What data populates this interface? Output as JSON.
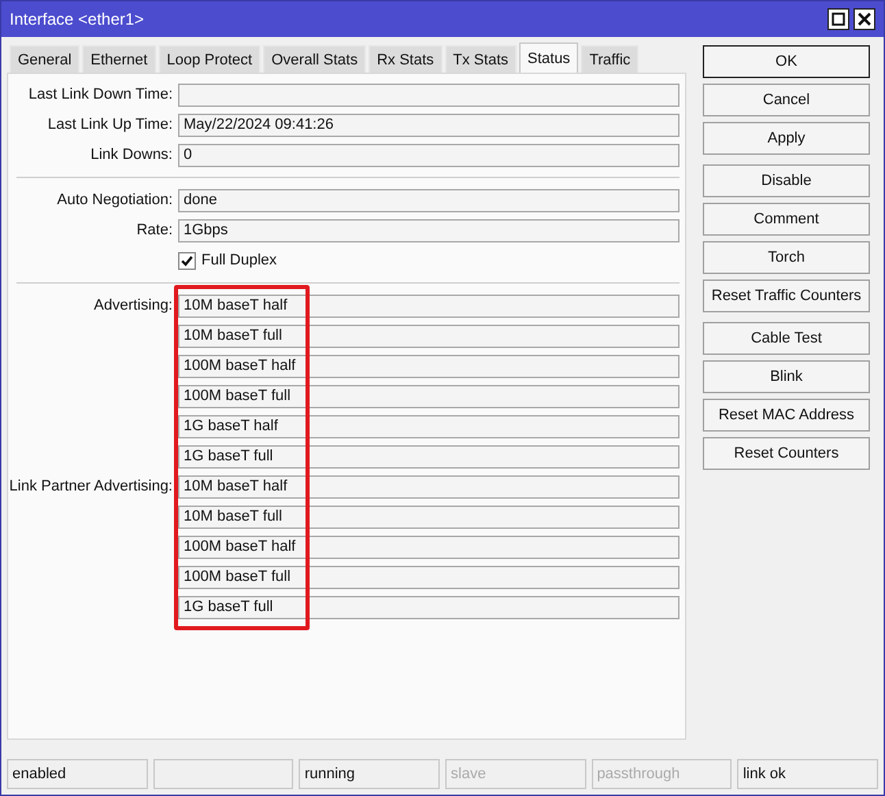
{
  "window": {
    "title": "Interface <ether1>"
  },
  "tabs": [
    {
      "label": "General",
      "selected": false
    },
    {
      "label": "Ethernet",
      "selected": false
    },
    {
      "label": "Loop Protect",
      "selected": false
    },
    {
      "label": "Overall Stats",
      "selected": false
    },
    {
      "label": "Rx Stats",
      "selected": false
    },
    {
      "label": "Tx Stats",
      "selected": false
    },
    {
      "label": "Status",
      "selected": true
    },
    {
      "label": "Traffic",
      "selected": false
    }
  ],
  "link_fields": [
    {
      "label": "Last Link Down Time:"
    },
    {
      "label": "Last Link Up Time:",
      "value": "May/22/2024 09:41:26"
    },
    {
      "label": "Link Downs:",
      "value": "0"
    }
  ],
  "negotiation_fields": [
    {
      "label": "Auto Negotiation:",
      "value": "done"
    },
    {
      "label": "Rate:",
      "value": "1Gbps"
    }
  ],
  "full_duplex": {
    "label": "Full Duplex",
    "checked": true
  },
  "advertising": {
    "label": "Advertising:",
    "items": [
      "10M baseT half",
      "10M baseT full",
      "100M baseT half",
      "100M baseT full",
      "1G baseT half",
      "1G baseT full"
    ]
  },
  "link_partner_advertising": {
    "label": "Link Partner Advertising:",
    "items": [
      "10M baseT half",
      "10M baseT full",
      "100M baseT half",
      "100M baseT full",
      "1G baseT full"
    ]
  },
  "button_groups": [
    [
      "OK",
      "Cancel",
      "Apply"
    ],
    [
      "Disable",
      "Comment",
      "Torch",
      "Reset Traffic Counters"
    ],
    [
      "Cable Test",
      "Blink",
      "Reset MAC Address",
      "Reset Counters"
    ]
  ],
  "status_bar": {
    "left": [
      {
        "text": "enabled",
        "disabled": false
      }
    ],
    "right": [
      {
        "text": "running",
        "disabled": false
      },
      {
        "text": "slave",
        "disabled": true
      },
      {
        "text": "passthrough",
        "disabled": true
      },
      {
        "text": "link ok",
        "disabled": false
      }
    ]
  }
}
